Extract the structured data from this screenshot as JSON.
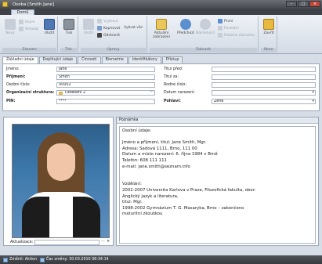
{
  "window": {
    "title": "Osoba [Smith Jane]"
  },
  "ribbon": {
    "tab": "Domů",
    "groups": [
      {
        "label": "Záznam",
        "buttons": [
          "Nový",
          "Kopie",
          "Smazat",
          "Uložit"
        ]
      },
      {
        "label": "Tisk",
        "buttons": [
          "Tisk"
        ]
      },
      {
        "label": "Úpravy",
        "buttons": [
          "Vložit",
          "Vyjmout",
          "Kopírovat",
          "Odstranit",
          "Vybrat vše"
        ]
      },
      {
        "label": "Zobrazit",
        "buttons": [
          "Aktuální zobrazení",
          "Předchozí",
          "Následující",
          "První",
          "Poslední",
          "Historie záznamu"
        ]
      },
      {
        "label": "Okno",
        "buttons": [
          "Zavřít"
        ]
      }
    ]
  },
  "tabs": [
    "Základní údaje",
    "Doplňující údaje",
    "Činnosti",
    "Biometrie",
    "Identifikátory",
    "Přístup"
  ],
  "form": {
    "left": [
      {
        "label": "Jméno:",
        "value": "Jane",
        "bold": false
      },
      {
        "label": "Příjmení:",
        "value": "Smith",
        "bold": true
      },
      {
        "label": "Osobní číslo:",
        "value": "X0002",
        "bold": false
      },
      {
        "label": "Organizační struktura:",
        "value": "Oddělení 2",
        "bold": true
      },
      {
        "label": "PIN:",
        "value": "****",
        "bold": true
      }
    ],
    "right": [
      {
        "label": "Titul před:",
        "value": "",
        "bold": false
      },
      {
        "label": "Titul za:",
        "value": "",
        "bold": false
      },
      {
        "label": "Rodné číslo:",
        "value": "",
        "bold": false
      },
      {
        "label": "Datum narození:",
        "value": "",
        "bold": false
      },
      {
        "label": "Pohlaví:",
        "value": "Žena",
        "bold": true
      }
    ]
  },
  "photo": {
    "update_label": "Aktualizace:"
  },
  "note": {
    "header": "Poznámka",
    "lines": [
      "Osobní údaje:",
      "",
      "Jméno a příjmení, titul:   Jane Smith, Mgr.",
      "Adresa:  Sadová 1111, Brno, 111 00",
      "Datum a místo narození:   6. října 1984 v Brně",
      "Telefon:  608 111 111",
      "e-mail:   jane.smith@seznam.info",
      "",
      "",
      "Vzdělání:",
      "2002-2007   Univerzita Karlova v Praze, Filozofická fakulta, obor:",
      "Anglický jazyk a literatura,",
      "titul: Mgr.",
      "1998-2002   Gymnázium T. G. Masaryka, Brno – zakončeno",
      "maturitní zkouškou"
    ]
  },
  "status": {
    "changed_label": "Změnil: Aktion",
    "time_label": "Čas změny: 30.03.2010 08:34:14"
  }
}
